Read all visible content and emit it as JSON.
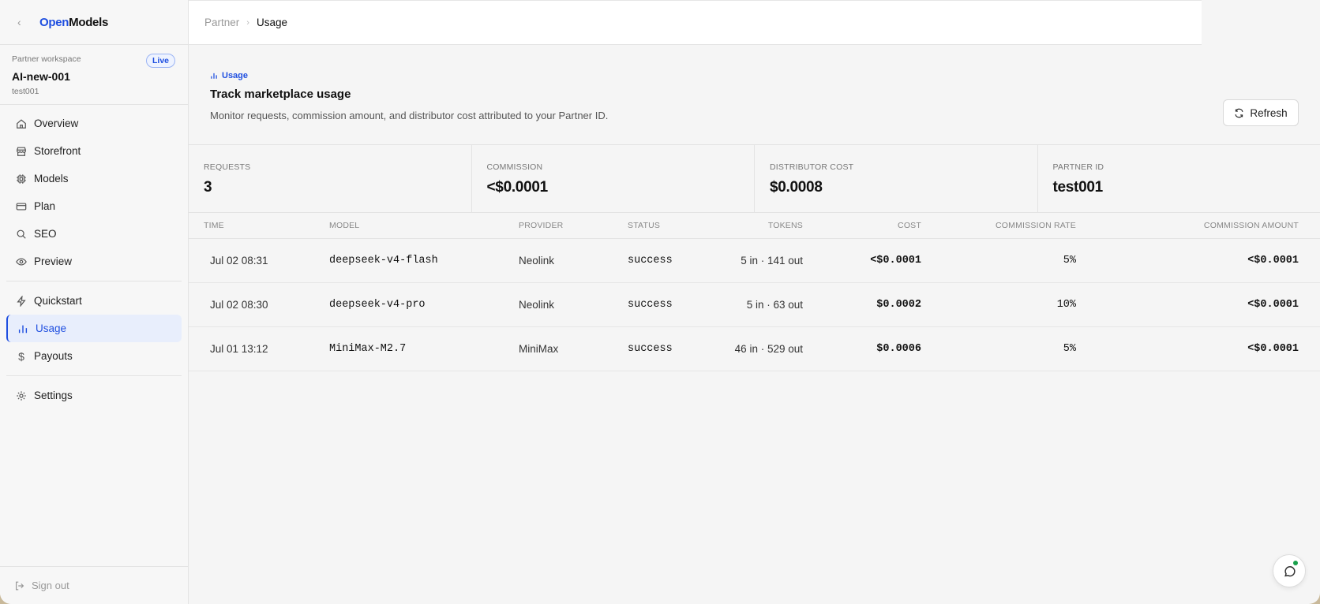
{
  "brand": {
    "open": "Open",
    "models": "Models"
  },
  "workspace": {
    "label": "Partner workspace",
    "badge": "Live",
    "name": "AI-new-001",
    "id": "test001"
  },
  "nav": {
    "overview": "Overview",
    "storefront": "Storefront",
    "models": "Models",
    "plan": "Plan",
    "seo": "SEO",
    "preview": "Preview",
    "quickstart": "Quickstart",
    "usage": "Usage",
    "payouts": "Payouts",
    "settings": "Settings",
    "signout": "Sign out"
  },
  "breadcrumb": {
    "parent": "Partner",
    "current": "Usage"
  },
  "header": {
    "tag": "Usage",
    "title": "Track marketplace usage",
    "subtitle": "Monitor requests, commission amount, and distributor cost attributed to your Partner ID.",
    "refresh": "Refresh"
  },
  "stats": [
    {
      "label": "REQUESTS",
      "value": "3"
    },
    {
      "label": "COMMISSION",
      "value": "<$0.0001"
    },
    {
      "label": "DISTRIBUTOR COST",
      "value": "$0.0008"
    },
    {
      "label": "PARTNER ID",
      "value": "test001"
    }
  ],
  "table": {
    "columns": [
      "TIME",
      "MODEL",
      "PROVIDER",
      "STATUS",
      "TOKENS",
      "COST",
      "COMMISSION RATE",
      "COMMISSION AMOUNT"
    ],
    "rows": [
      {
        "time": "Jul 02 08:31",
        "model": "deepseek-v4-flash",
        "provider": "Neolink",
        "status": "success",
        "tokens": "5 in · 141 out",
        "cost": "<$0.0001",
        "rate": "5%",
        "amount": "<$0.0001"
      },
      {
        "time": "Jul 02 08:30",
        "model": "deepseek-v4-pro",
        "provider": "Neolink",
        "status": "success",
        "tokens": "5 in · 63 out",
        "cost": "$0.0002",
        "rate": "10%",
        "amount": "<$0.0001"
      },
      {
        "time": "Jul 01 13:12",
        "model": "MiniMax-M2.7",
        "provider": "MiniMax",
        "status": "success",
        "tokens": "46 in · 529 out",
        "cost": "$0.0006",
        "rate": "5%",
        "amount": "<$0.0001"
      }
    ]
  },
  "colors": {
    "accent": "#1f4fe0",
    "online": "#18a04a"
  }
}
